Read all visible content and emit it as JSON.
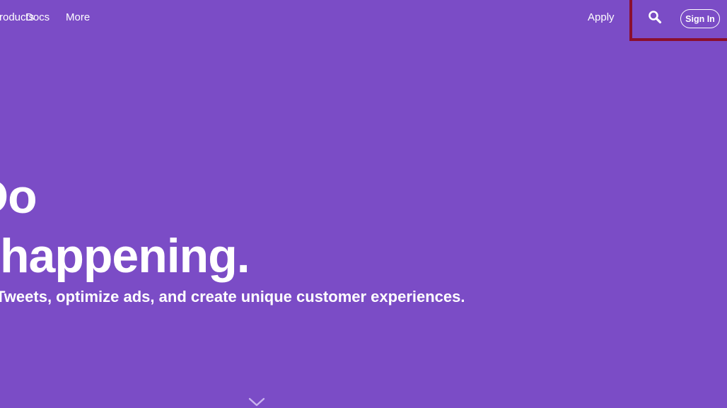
{
  "nav": {
    "products_label": "Products",
    "docs_label": "Docs",
    "more_label": "More",
    "apply_label": "Apply",
    "signin_label": "Sign In"
  },
  "hero": {
    "line1": "Do",
    "line2": "happening.",
    "subtitle": "Tweets, optimize ads, and create unique customer experiences."
  },
  "colors": {
    "background": "#7b4cc6",
    "text": "#ffffff",
    "highlight": "#8a0f2e"
  },
  "icons": {
    "search": "search-icon",
    "scroll": "chevron-down-icon"
  }
}
